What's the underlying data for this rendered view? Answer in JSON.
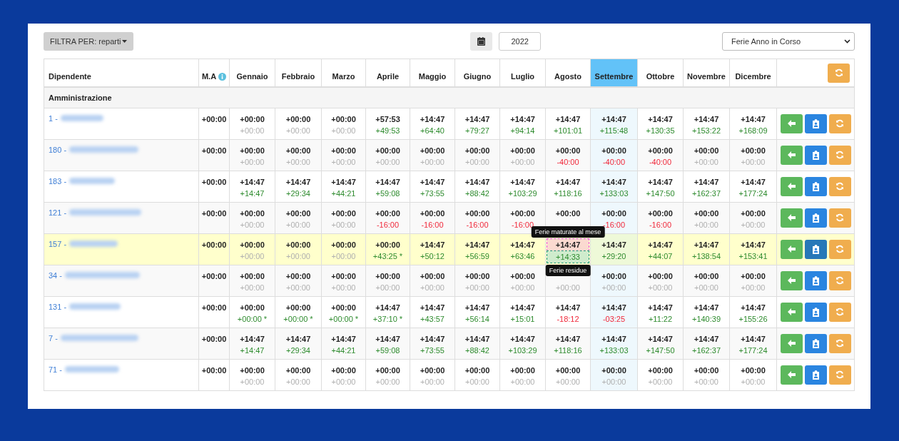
{
  "toolbar": {
    "filter_button": "FILTRA PER: reparti",
    "year": "2022",
    "period_select": "Ferie Anno in Corso"
  },
  "table": {
    "employee_header": "Dipendente",
    "ma_header": "M.A",
    "months": [
      {
        "label": "Gennaio",
        "selected": false
      },
      {
        "label": "Febbraio",
        "selected": false
      },
      {
        "label": "Marzo",
        "selected": false
      },
      {
        "label": "Aprile",
        "selected": false
      },
      {
        "label": "Maggio",
        "selected": false
      },
      {
        "label": "Giugno",
        "selected": false
      },
      {
        "label": "Luglio",
        "selected": false
      },
      {
        "label": "Agosto",
        "selected": false
      },
      {
        "label": "Settembre",
        "selected": true
      },
      {
        "label": "Ottobre",
        "selected": false
      },
      {
        "label": "Novembre",
        "selected": false
      },
      {
        "label": "Dicembre",
        "selected": false
      }
    ],
    "group": "Amministrazione",
    "rows": [
      {
        "id": "1 -",
        "selected": false,
        "ma": "+00:00",
        "cells": [
          {
            "top": "+00:00",
            "bottom": "+00:00",
            "kind": "muted"
          },
          {
            "top": "+00:00",
            "bottom": "+00:00",
            "kind": "muted"
          },
          {
            "top": "+00:00",
            "bottom": "+00:00",
            "kind": "muted"
          },
          {
            "top": "+57:53",
            "bottom": "+49:53",
            "kind": "positive"
          },
          {
            "top": "+14:47",
            "bottom": "+64:40",
            "kind": "positive"
          },
          {
            "top": "+14:47",
            "bottom": "+79:27",
            "kind": "positive"
          },
          {
            "top": "+14:47",
            "bottom": "+94:14",
            "kind": "positive"
          },
          {
            "top": "+14:47",
            "bottom": "+101:01",
            "kind": "positive"
          },
          {
            "top": "+14:47",
            "bottom": "+115:48",
            "kind": "positive"
          },
          {
            "top": "+14:47",
            "bottom": "+130:35",
            "kind": "positive"
          },
          {
            "top": "+14:47",
            "bottom": "+153:22",
            "kind": "positive"
          },
          {
            "top": "+14:47",
            "bottom": "+168:09",
            "kind": "positive"
          }
        ]
      },
      {
        "id": "180 -",
        "selected": false,
        "ma": "+00:00",
        "cells": [
          {
            "top": "+00:00",
            "bottom": "+00:00",
            "kind": "muted"
          },
          {
            "top": "+00:00",
            "bottom": "+00:00",
            "kind": "muted"
          },
          {
            "top": "+00:00",
            "bottom": "+00:00",
            "kind": "muted"
          },
          {
            "top": "+00:00",
            "bottom": "+00:00",
            "kind": "muted"
          },
          {
            "top": "+00:00",
            "bottom": "+00:00",
            "kind": "muted"
          },
          {
            "top": "+00:00",
            "bottom": "+00:00",
            "kind": "muted"
          },
          {
            "top": "+00:00",
            "bottom": "+00:00",
            "kind": "muted"
          },
          {
            "top": "+00:00",
            "bottom": "-40:00",
            "kind": "negative"
          },
          {
            "top": "+00:00",
            "bottom": "-40:00",
            "kind": "negative"
          },
          {
            "top": "+00:00",
            "bottom": "-40:00",
            "kind": "negative"
          },
          {
            "top": "+00:00",
            "bottom": "+00:00",
            "kind": "muted"
          },
          {
            "top": "+00:00",
            "bottom": "+00:00",
            "kind": "muted"
          }
        ]
      },
      {
        "id": "183 -",
        "selected": false,
        "ma": "+00:00",
        "cells": [
          {
            "top": "+14:47",
            "bottom": "+14:47",
            "kind": "positive"
          },
          {
            "top": "+14:47",
            "bottom": "+29:34",
            "kind": "positive"
          },
          {
            "top": "+14:47",
            "bottom": "+44:21",
            "kind": "positive"
          },
          {
            "top": "+14:47",
            "bottom": "+59:08",
            "kind": "positive"
          },
          {
            "top": "+14:47",
            "bottom": "+73:55",
            "kind": "positive"
          },
          {
            "top": "+14:47",
            "bottom": "+88:42",
            "kind": "positive"
          },
          {
            "top": "+14:47",
            "bottom": "+103:29",
            "kind": "positive"
          },
          {
            "top": "+14:47",
            "bottom": "+118:16",
            "kind": "positive"
          },
          {
            "top": "+14:47",
            "bottom": "+133:03",
            "kind": "positive"
          },
          {
            "top": "+14:47",
            "bottom": "+147:50",
            "kind": "positive"
          },
          {
            "top": "+14:47",
            "bottom": "+162:37",
            "kind": "positive"
          },
          {
            "top": "+14:47",
            "bottom": "+177:24",
            "kind": "positive"
          }
        ]
      },
      {
        "id": "121 -",
        "selected": false,
        "ma": "+00:00",
        "cells": [
          {
            "top": "+00:00",
            "bottom": "+00:00",
            "kind": "muted"
          },
          {
            "top": "+00:00",
            "bottom": "+00:00",
            "kind": "muted"
          },
          {
            "top": "+00:00",
            "bottom": "+00:00",
            "kind": "muted"
          },
          {
            "top": "+00:00",
            "bottom": "-16:00",
            "kind": "negative"
          },
          {
            "top": "+00:00",
            "bottom": "-16:00",
            "kind": "negative"
          },
          {
            "top": "+00:00",
            "bottom": "-16:00",
            "kind": "negative"
          },
          {
            "top": "+00:00",
            "bottom": "-16:00",
            "kind": "negative"
          },
          {
            "top": "+00:00"
          },
          {
            "top": "+00:00",
            "bottom": "-16:00",
            "kind": "negative"
          },
          {
            "top": "+00:00",
            "bottom": "-16:00",
            "kind": "negative"
          },
          {
            "top": "+00:00",
            "bottom": "+00:00",
            "kind": "muted"
          },
          {
            "top": "+00:00",
            "bottom": "+00:00",
            "kind": "muted"
          }
        ]
      },
      {
        "id": "157 -",
        "selected": true,
        "ma": "+00:00",
        "cells": [
          {
            "top": "+00:00",
            "bottom": "+00:00",
            "kind": "muted"
          },
          {
            "top": "+00:00",
            "bottom": "+00:00",
            "kind": "muted"
          },
          {
            "top": "+00:00",
            "bottom": "+00:00",
            "kind": "muted"
          },
          {
            "top": "+00:00",
            "bottom": "+43:25 *",
            "kind": "positive"
          },
          {
            "top": "+14:47",
            "bottom": "+50:12",
            "kind": "positive"
          },
          {
            "top": "+14:47",
            "bottom": "+56:59",
            "kind": "positive"
          },
          {
            "top": "+14:47",
            "bottom": "+63:46",
            "kind": "positive"
          },
          {
            "top": "+14:47",
            "bottom": "+14:33",
            "kind": "positive",
            "tip_top": "Ferie maturate al mese",
            "tip_bottom": "Ferie residue"
          },
          {
            "top": "+14:47",
            "bottom": "+29:20",
            "kind": "positive"
          },
          {
            "top": "+14:47",
            "bottom": "+44:07",
            "kind": "positive"
          },
          {
            "top": "+14:47",
            "bottom": "+138:54",
            "kind": "positive"
          },
          {
            "top": "+14:47",
            "bottom": "+153:41",
            "kind": "positive"
          }
        ]
      },
      {
        "id": "34 -",
        "selected": false,
        "ma": "+00:00",
        "cells": [
          {
            "top": "+00:00",
            "bottom": "+00:00",
            "kind": "muted"
          },
          {
            "top": "+00:00",
            "bottom": "+00:00",
            "kind": "muted"
          },
          {
            "top": "+00:00",
            "bottom": "+00:00",
            "kind": "muted"
          },
          {
            "top": "+00:00",
            "bottom": "+00:00",
            "kind": "muted"
          },
          {
            "top": "+00:00",
            "bottom": "+00:00",
            "kind": "muted"
          },
          {
            "top": "+00:00",
            "bottom": "+00:00",
            "kind": "muted"
          },
          {
            "top": "+00:00",
            "bottom": "+00:00",
            "kind": "muted"
          },
          {
            "bottom": "+00:00",
            "kind": "muted"
          },
          {
            "top": "+00:00",
            "bottom": "+00:00",
            "kind": "muted"
          },
          {
            "top": "+00:00",
            "bottom": "+00:00",
            "kind": "muted"
          },
          {
            "top": "+00:00",
            "bottom": "+00:00",
            "kind": "muted"
          },
          {
            "top": "+00:00",
            "bottom": "+00:00",
            "kind": "muted"
          }
        ]
      },
      {
        "id": "131 -",
        "selected": false,
        "ma": "+00:00",
        "cells": [
          {
            "top": "+00:00",
            "bottom": "+00:00 *",
            "kind": "positive"
          },
          {
            "top": "+00:00",
            "bottom": "+00:00 *",
            "kind": "positive"
          },
          {
            "top": "+00:00",
            "bottom": "+00:00 *",
            "kind": "positive"
          },
          {
            "top": "+14:47",
            "bottom": "+37:10 *",
            "kind": "positive"
          },
          {
            "top": "+14:47",
            "bottom": "+43:57",
            "kind": "positive"
          },
          {
            "top": "+14:47",
            "bottom": "+56:14",
            "kind": "positive"
          },
          {
            "top": "+14:47",
            "bottom": "+15:01",
            "kind": "positive"
          },
          {
            "top": "+14:47",
            "bottom": "-18:12",
            "kind": "negative"
          },
          {
            "top": "+14:47",
            "bottom": "-03:25",
            "kind": "negative"
          },
          {
            "top": "+14:47",
            "bottom": "+11:22",
            "kind": "positive"
          },
          {
            "top": "+14:47",
            "bottom": "+140:39",
            "kind": "positive"
          },
          {
            "top": "+14:47",
            "bottom": "+155:26",
            "kind": "positive"
          }
        ]
      },
      {
        "id": "7 -",
        "selected": false,
        "ma": "+00:00",
        "cells": [
          {
            "top": "+14:47",
            "bottom": "+14:47",
            "kind": "positive"
          },
          {
            "top": "+14:47",
            "bottom": "+29:34",
            "kind": "positive"
          },
          {
            "top": "+14:47",
            "bottom": "+44:21",
            "kind": "positive"
          },
          {
            "top": "+14:47",
            "bottom": "+59:08",
            "kind": "positive"
          },
          {
            "top": "+14:47",
            "bottom": "+73:55",
            "kind": "positive"
          },
          {
            "top": "+14:47",
            "bottom": "+88:42",
            "kind": "positive"
          },
          {
            "top": "+14:47",
            "bottom": "+103:29",
            "kind": "positive"
          },
          {
            "top": "+14:47",
            "bottom": "+118:16",
            "kind": "positive"
          },
          {
            "top": "+14:47",
            "bottom": "+133:03",
            "kind": "positive"
          },
          {
            "top": "+14:47",
            "bottom": "+147:50",
            "kind": "positive"
          },
          {
            "top": "+14:47",
            "bottom": "+162:37",
            "kind": "positive"
          },
          {
            "top": "+14:47",
            "bottom": "+177:24",
            "kind": "positive"
          }
        ]
      },
      {
        "id": "71 -",
        "selected": false,
        "ma": "+00:00",
        "cells": [
          {
            "top": "+00:00",
            "bottom": "+00:00",
            "kind": "muted"
          },
          {
            "top": "+00:00",
            "bottom": "+00:00",
            "kind": "muted"
          },
          {
            "top": "+00:00",
            "bottom": "+00:00",
            "kind": "muted"
          },
          {
            "top": "+00:00",
            "bottom": "+00:00",
            "kind": "muted"
          },
          {
            "top": "+00:00",
            "bottom": "+00:00",
            "kind": "muted"
          },
          {
            "top": "+00:00",
            "bottom": "+00:00",
            "kind": "muted"
          },
          {
            "top": "+00:00",
            "bottom": "+00:00",
            "kind": "muted"
          },
          {
            "top": "+00:00",
            "bottom": "+00:00",
            "kind": "muted"
          },
          {
            "top": "+00:00",
            "bottom": "+00:00",
            "kind": "muted"
          },
          {
            "top": "+00:00",
            "bottom": "+00:00",
            "kind": "muted"
          },
          {
            "top": "+00:00",
            "bottom": "+00:00",
            "kind": "muted"
          },
          {
            "top": "+00:00",
            "bottom": "+00:00",
            "kind": "muted"
          }
        ]
      }
    ]
  }
}
